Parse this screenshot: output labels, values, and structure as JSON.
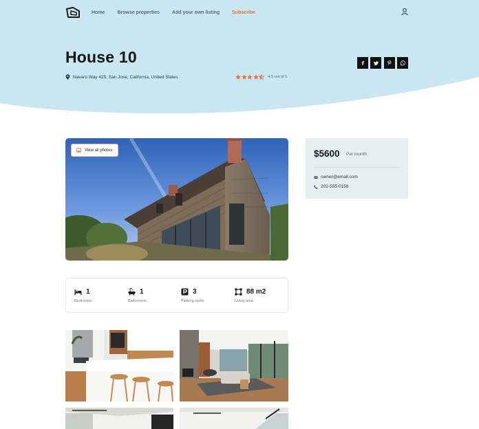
{
  "nav": {
    "links": [
      {
        "label": "Home"
      },
      {
        "label": "Browse properties"
      },
      {
        "label": "Add your own listing"
      },
      {
        "label": "Subscribe"
      }
    ]
  },
  "listing": {
    "title": "House 10",
    "address": "Navaro Way 425, San Jose, California, United States",
    "rating_value": 4.5,
    "rating_text": "4.5 out of 5"
  },
  "share": [
    "f",
    "t",
    "p",
    "w"
  ],
  "photo": {
    "view_all_label": "View all photos"
  },
  "price_card": {
    "price": "$5600",
    "period": "Per month",
    "email": "owner@email.com",
    "phone": "202-555-0158"
  },
  "features": [
    {
      "value": "1",
      "label": "Bedrooms",
      "icon": "bed-icon"
    },
    {
      "value": "1",
      "label": "Bathrooms",
      "icon": "bathtub-icon"
    },
    {
      "value": "3",
      "label": "Parking spots",
      "icon": "parking-icon"
    },
    {
      "value": "88 m2",
      "label": "Living area",
      "icon": "area-icon"
    }
  ],
  "colors": {
    "hero_bg": "#cae6f1",
    "accent": "#f06a3a",
    "card_bg": "#e5eff2"
  }
}
